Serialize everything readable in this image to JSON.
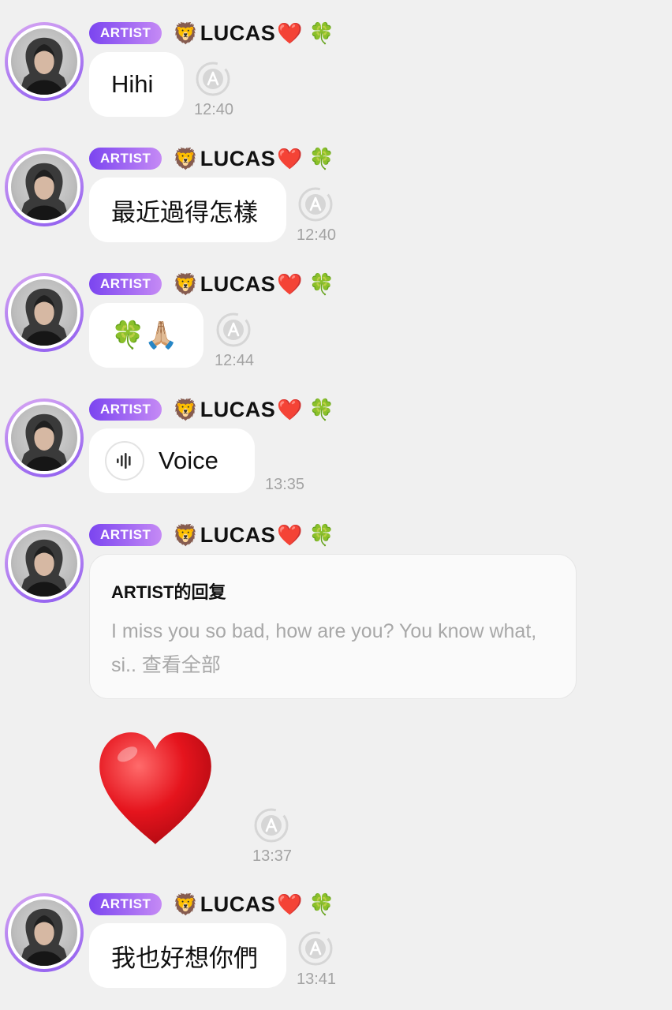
{
  "sender": {
    "badge": "ARTIST",
    "lion_emoji": "🦁",
    "name": "LUCAS",
    "heart_emoji": "❤️",
    "clover_emoji": "🍀"
  },
  "messages": [
    {
      "type": "text",
      "text": "Hihi",
      "time": "12:40"
    },
    {
      "type": "text",
      "text": "最近過得怎樣",
      "time": "12:40"
    },
    {
      "type": "emoji",
      "text": "🍀🙏🏼",
      "time": "12:44"
    },
    {
      "type": "voice",
      "text": "Voice",
      "time": "13:35"
    },
    {
      "type": "reply",
      "reply_title": "ARTIST的回复",
      "reply_preview": "I miss you so bad, how are you? You know what, si..",
      "view_all": "查看全部"
    },
    {
      "type": "sticker",
      "emoji": "heart",
      "time": "13:37"
    },
    {
      "type": "text",
      "text": "我也好想你們",
      "time": "13:41"
    }
  ],
  "colors": {
    "background": "#f0f0f0",
    "badge_gradient_start": "#7b45f0",
    "badge_gradient_end": "#c58af5",
    "avatar_ring": "#a36df2",
    "timestamp": "#a3a3a3",
    "heart": "#e5141d"
  }
}
